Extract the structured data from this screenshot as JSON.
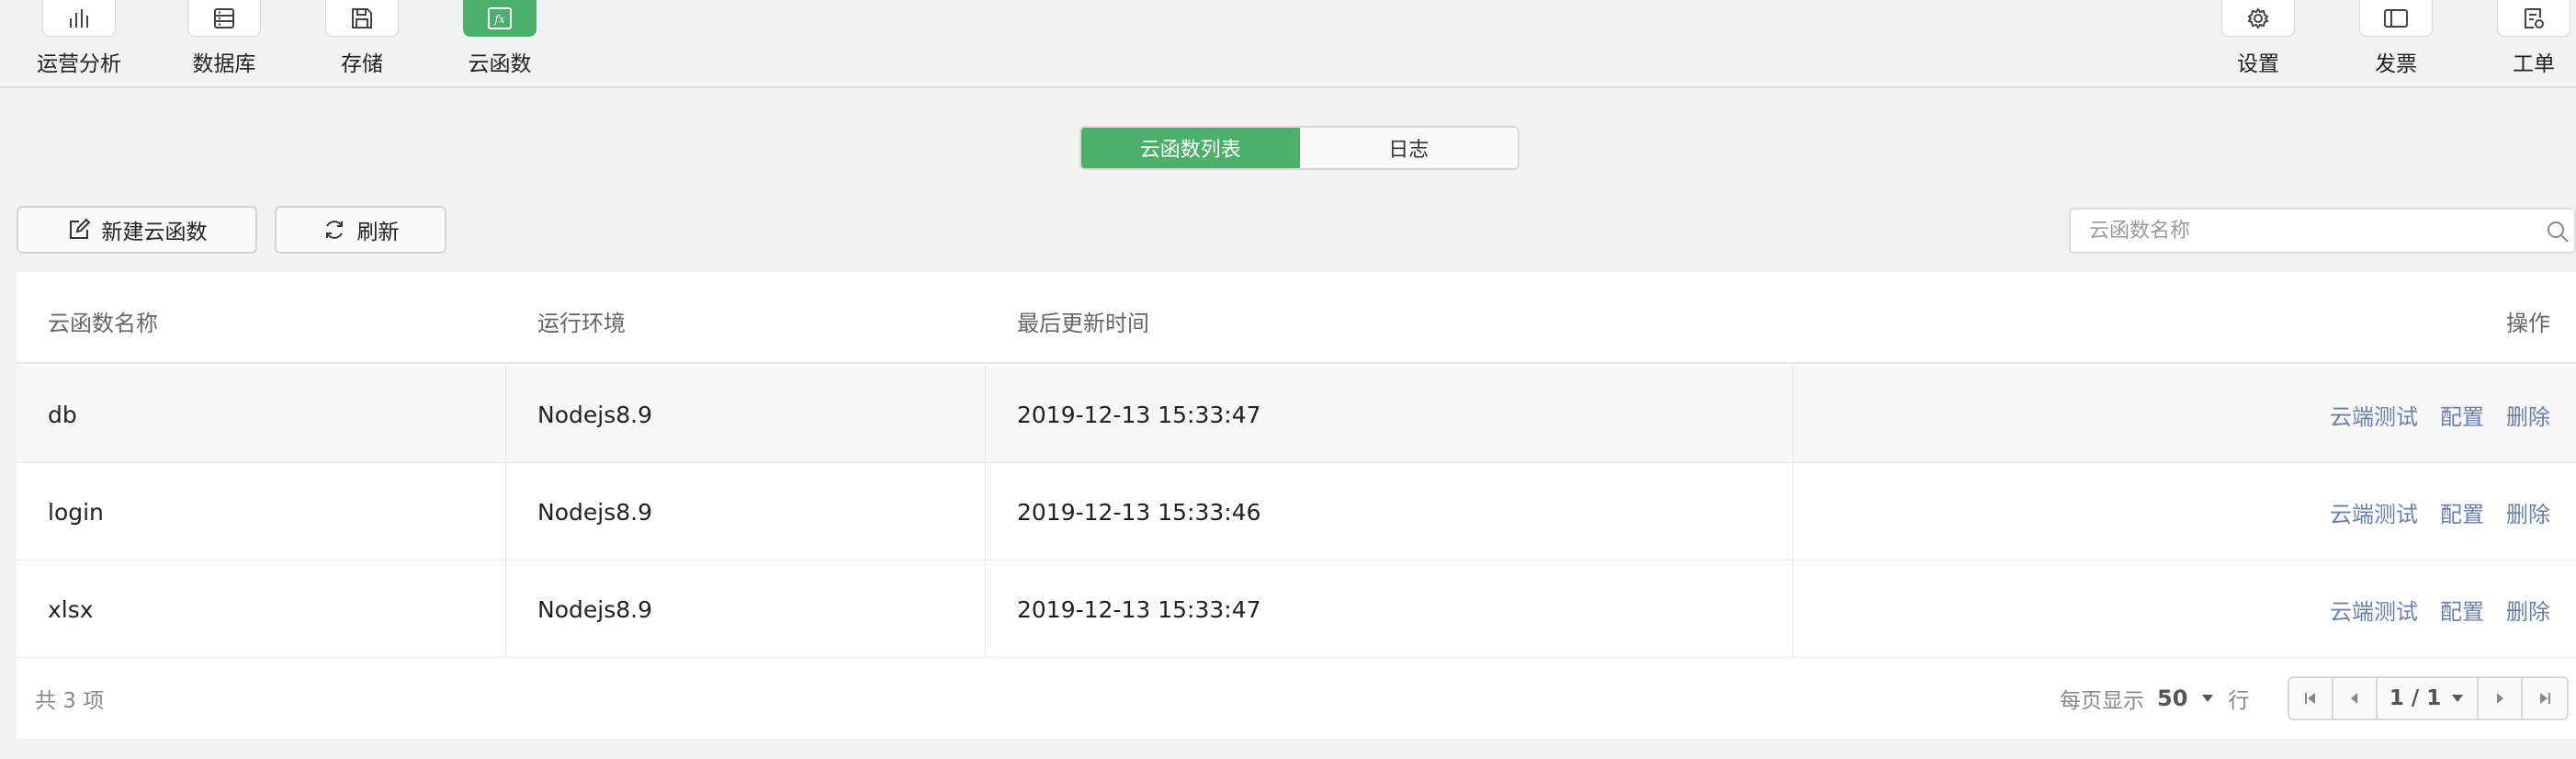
{
  "toolbar": {
    "left_items": [
      {
        "label": "运营分析",
        "icon": "bar-chart-icon"
      },
      {
        "label": "数据库",
        "icon": "database-icon"
      },
      {
        "label": "存储",
        "icon": "save-icon"
      },
      {
        "label": "云函数",
        "icon": "function-icon"
      }
    ],
    "right_items": [
      {
        "label": "设置",
        "icon": "gear-icon"
      },
      {
        "label": "发票",
        "icon": "invoice-icon"
      },
      {
        "label": "工单",
        "icon": "ticket-icon"
      }
    ],
    "function_icon_text": "fx",
    "accent_color": "#4caf6a"
  },
  "tabs": [
    {
      "label": "云函数列表",
      "active": true
    },
    {
      "label": "日志",
      "active": false
    }
  ],
  "actions": {
    "new_label": "新建云函数",
    "refresh_label": "刷新"
  },
  "search": {
    "placeholder": "云函数名称",
    "value": ""
  },
  "table": {
    "headers": [
      "云函数名称",
      "运行环境",
      "最后更新时间",
      "操作"
    ],
    "rows": [
      {
        "name": "db",
        "runtime": "Nodejs8.9",
        "updated": "2019-12-13 15:33:47"
      },
      {
        "name": "login",
        "runtime": "Nodejs8.9",
        "updated": "2019-12-13 15:33:46"
      },
      {
        "name": "xlsx",
        "runtime": "Nodejs8.9",
        "updated": "2019-12-13 15:33:47"
      }
    ],
    "row_actions": [
      "云端测试",
      "配置",
      "删除"
    ],
    "link_color": "#6b80a8"
  },
  "footer": {
    "total_text": "共 3 项",
    "per_page_label": "每页显示",
    "per_page_value": "50",
    "per_page_unit": "行",
    "page_indicator": "1 / 1"
  }
}
